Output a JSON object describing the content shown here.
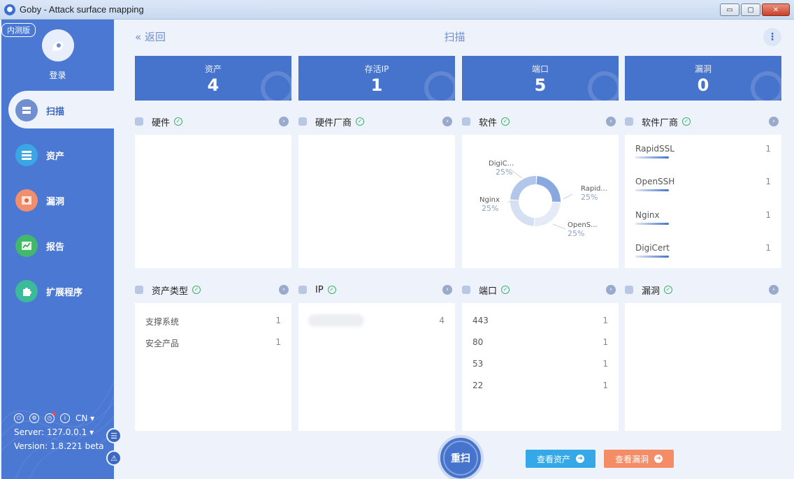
{
  "window": {
    "title": "Goby - Attack surface mapping",
    "btn_min": "▭",
    "btn_max": "▢",
    "btn_close": "✕"
  },
  "sidebar": {
    "badge": "内测版",
    "login": "登录",
    "items": [
      {
        "label": "扫描",
        "icon": "scan-icon",
        "color": "#6f8fd0"
      },
      {
        "label": "资产",
        "icon": "asset-icon",
        "color": "#3aa7e4"
      },
      {
        "label": "漏洞",
        "icon": "bug-icon",
        "color": "#f28e6b"
      },
      {
        "label": "报告",
        "icon": "report-icon",
        "color": "#41b86a"
      },
      {
        "label": "扩展程序",
        "icon": "puzzle-icon",
        "color": "#3bbb9a"
      }
    ],
    "lang": "CN ▾",
    "server": "Server: 127.0.0.1 ▾",
    "version": "Version: 1.8.221 beta"
  },
  "header": {
    "back": "« 返回",
    "title": "扫描"
  },
  "stats": [
    {
      "label": "资产",
      "value": "4"
    },
    {
      "label": "存活IP",
      "value": "1"
    },
    {
      "label": "端口",
      "value": "5"
    },
    {
      "label": "漏洞",
      "value": "0"
    }
  ],
  "panels": {
    "hardware": {
      "title": "硬件"
    },
    "hw_vendor": {
      "title": "硬件厂商"
    },
    "software": {
      "title": "软件"
    },
    "sw_vendor": {
      "title": "软件厂商",
      "items": [
        {
          "name": "RapidSSL",
          "count": "1"
        },
        {
          "name": "OpenSSH",
          "count": "1"
        },
        {
          "name": "Nginx",
          "count": "1"
        },
        {
          "name": "DigiCert",
          "count": "1"
        }
      ]
    },
    "asset_type": {
      "title": "资产类型",
      "items": [
        {
          "name": "支撑系统",
          "count": "1"
        },
        {
          "name": "安全产品",
          "count": "1"
        }
      ]
    },
    "ip": {
      "title": "IP",
      "items": [
        {
          "count": "4"
        }
      ]
    },
    "ports": {
      "title": "端口",
      "items": [
        {
          "name": "443",
          "count": "1"
        },
        {
          "name": "80",
          "count": "1"
        },
        {
          "name": "53",
          "count": "1"
        },
        {
          "name": "22",
          "count": "1"
        }
      ]
    },
    "vulns": {
      "title": "漏洞"
    }
  },
  "chart_data": {
    "type": "pie",
    "categories": [
      "DigiC...",
      "Rapid...",
      "OpenS...",
      "Nginx"
    ],
    "values": [
      25,
      25,
      25,
      25
    ],
    "labels_pct": [
      "25%",
      "25%",
      "25%",
      "25%"
    ],
    "colors": [
      "#8aa8e0",
      "#e4eaf6",
      "#d5e0f3",
      "#b2c6ea"
    ]
  },
  "actions": {
    "rescan": "重扫",
    "view_assets": "查看资产",
    "view_vulns": "查看漏洞",
    "arrow": "➜"
  },
  "colors": {
    "accent": "#4673cb",
    "assets_btn": "#35a8e8",
    "vulns_btn": "#f48c66"
  }
}
